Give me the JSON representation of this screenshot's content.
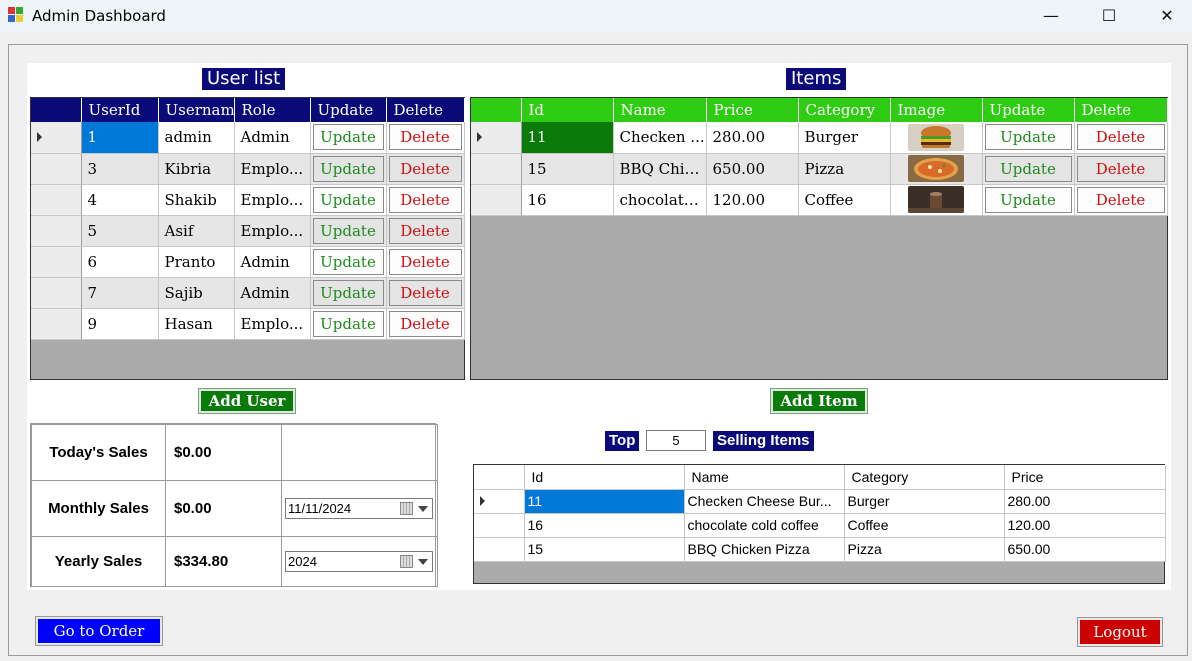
{
  "window": {
    "title": "Admin Dashboard",
    "minimize": "—",
    "maximize": "☐",
    "close": "✕"
  },
  "users": {
    "title": "User list",
    "columns": [
      "UserId",
      "Usernam",
      "Role",
      "Update",
      "Delete"
    ],
    "rows": [
      {
        "id": "1",
        "username": "admin",
        "role": "Admin"
      },
      {
        "id": "3",
        "username": "Kibria",
        "role": "Emplo..."
      },
      {
        "id": "4",
        "username": "Shakib",
        "role": "Emplo..."
      },
      {
        "id": "5",
        "username": "Asif",
        "role": "Emplo..."
      },
      {
        "id": "6",
        "username": "Pranto",
        "role": "Admin"
      },
      {
        "id": "7",
        "username": "Sajib",
        "role": "Admin"
      },
      {
        "id": "9",
        "username": "Hasan",
        "role": "Emplo..."
      }
    ],
    "update_label": "Update",
    "delete_label": "Delete",
    "add_label": "Add User"
  },
  "items": {
    "title": "Items",
    "columns": [
      "Id",
      "Name",
      "Price",
      "Category",
      "Image",
      "Update",
      "Delete"
    ],
    "rows": [
      {
        "id": "11",
        "name": "Checken ...",
        "price": "280.00",
        "category": "Burger",
        "image": "burger-image"
      },
      {
        "id": "15",
        "name": "BBQ Chic...",
        "price": "650.00",
        "category": "Pizza",
        "image": "pizza-image"
      },
      {
        "id": "16",
        "name": "chocolate...",
        "price": "120.00",
        "category": "Coffee",
        "image": "coffee-image"
      }
    ],
    "update_label": "Update",
    "delete_label": "Delete",
    "add_label": "Add Item"
  },
  "sales": {
    "today_label": "Today's Sales",
    "today_value": "$0.00",
    "monthly_label": "Monthly Sales",
    "monthly_value": "$0.00",
    "monthly_date": "11/11/2024",
    "yearly_label": "Yearly Sales",
    "yearly_value": "$334.80",
    "yearly_date": "2024"
  },
  "top_selling": {
    "top_label": "Top",
    "count": "5",
    "suffix_label": "Selling Items",
    "columns": [
      "Id",
      "Name",
      "Category",
      "Price"
    ],
    "rows": [
      {
        "id": "11",
        "name": "Checken Cheese Bur...",
        "category": "Burger",
        "price": "280.00"
      },
      {
        "id": "16",
        "name": "chocolate cold coffee",
        "category": "Coffee",
        "price": "120.00"
      },
      {
        "id": "15",
        "name": "BBQ Chicken Pizza",
        "category": "Pizza",
        "price": "650.00"
      }
    ]
  },
  "footer": {
    "order_label": "Go to Order",
    "logout_label": "Logout"
  },
  "colors": {
    "navy": "#0a0a78",
    "green_header": "#2ecc12",
    "dark_green": "#0a7a0a",
    "selection": "#0078d7",
    "order_blue": "#0000ff",
    "logout_red": "#cc0000"
  }
}
